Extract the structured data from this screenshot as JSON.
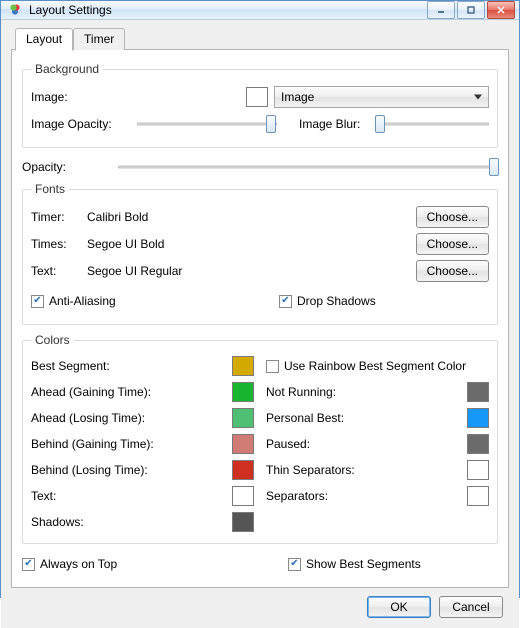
{
  "window": {
    "title": "Layout Settings"
  },
  "tabs": {
    "layout": "Layout",
    "timer": "Timer"
  },
  "background": {
    "legend": "Background",
    "image_label": "Image:",
    "bgcolor": "#ffffff",
    "dropdown_value": "Image",
    "opacity_label": "Image Opacity:",
    "blur_label": "Image Blur:"
  },
  "opacity_label": "Opacity:",
  "fonts": {
    "legend": "Fonts",
    "timer_label": "Timer:",
    "timer_value": "Calibri Bold",
    "times_label": "Times:",
    "times_value": "Segoe UI Bold",
    "text_label": "Text:",
    "text_value": "Segoe UI Regular",
    "choose": "Choose...",
    "antialias": "Anti-Aliasing",
    "dropshadows": "Drop Shadows"
  },
  "colors": {
    "legend": "Colors",
    "best_segment": "Best Segment:",
    "use_rainbow": "Use Rainbow Best Segment Color",
    "ahead_gain": "Ahead (Gaining Time):",
    "ahead_lose": "Ahead (Losing Time):",
    "behind_gain": "Behind (Gaining Time):",
    "behind_lose": "Behind (Losing Time):",
    "text": "Text:",
    "shadows": "Shadows:",
    "not_running": "Not Running:",
    "personal_best": "Personal Best:",
    "paused": "Paused:",
    "thin_sep": "Thin Separators:",
    "sep": "Separators:",
    "swatch": {
      "best_segment": "#d4a900",
      "ahead_gain": "#18b530",
      "ahead_lose": "#4fbf74",
      "behind_gain": "#cf7d74",
      "behind_lose": "#cf2f1f",
      "text": "#ffffff",
      "shadows": "#555555",
      "not_running": "#6b6b6b",
      "personal_best": "#1698f8",
      "paused": "#6b6b6b",
      "thin_sep": "#ffffff",
      "sep": "#ffffff"
    }
  },
  "bottom": {
    "always_on_top": "Always on Top",
    "show_best_segments": "Show Best Segments"
  },
  "buttons": {
    "ok": "OK",
    "cancel": "Cancel"
  }
}
